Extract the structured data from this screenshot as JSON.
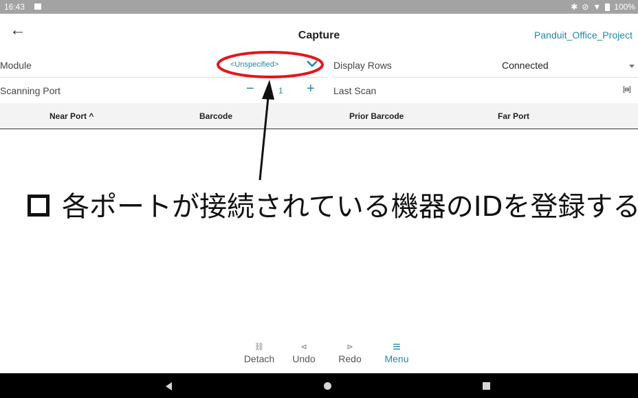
{
  "status_bar": {
    "time": "16:43",
    "battery": "100%"
  },
  "header": {
    "title": "Capture",
    "project": "Panduit_Office_Project"
  },
  "module": {
    "label": "Module",
    "value": "<Unspecified>"
  },
  "display_rows": {
    "label": "Display Rows",
    "value": "Connected"
  },
  "scanning_port": {
    "label": "Scanning Port",
    "value": "1"
  },
  "last_scan": {
    "label": "Last Scan"
  },
  "table": {
    "columns": [
      "Near Port",
      "Barcode",
      "Prior Barcode",
      "Far Port"
    ],
    "near_port_sort": "^"
  },
  "annotation": {
    "text": "各ポートが接続されている機器のIDを登録する"
  },
  "toolbar": {
    "detach": "Detach",
    "undo": "Undo",
    "redo": "Redo",
    "menu": "Menu"
  },
  "colors": {
    "accent": "#1f87a8",
    "annotation_red": "#e8141c"
  }
}
